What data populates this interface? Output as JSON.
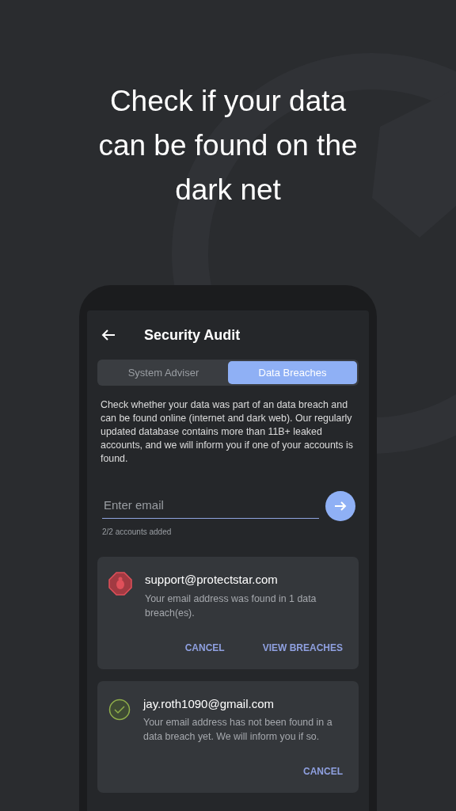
{
  "headline": "Check if your data can be found on the dark net",
  "app": {
    "title": "Security Audit",
    "tabs": [
      {
        "label": "System Adviser",
        "selected": false
      },
      {
        "label": "Data Breaches",
        "selected": true
      }
    ],
    "description": "Check whether your data was part of an data breach and can be found online (internet and dark web). Our regularly updated database contains more than 11B+ leaked accounts, and we will inform you if one of your accounts is found.",
    "email_field": {
      "placeholder": "Enter email"
    },
    "accounts_note": "2/2 accounts added",
    "accounts": [
      {
        "email": "support@protectstar.com",
        "kind": "breached",
        "message": "Your email address was found in 1 data breach(es).",
        "actions": [
          "CANCEL",
          "VIEW BREACHES"
        ]
      },
      {
        "email": "jay.roth1090@gmail.com",
        "kind": "clean",
        "message": "Your email address has not been found in a data breach yet. We will inform you if so.",
        "actions": [
          "CANCEL"
        ]
      }
    ]
  }
}
